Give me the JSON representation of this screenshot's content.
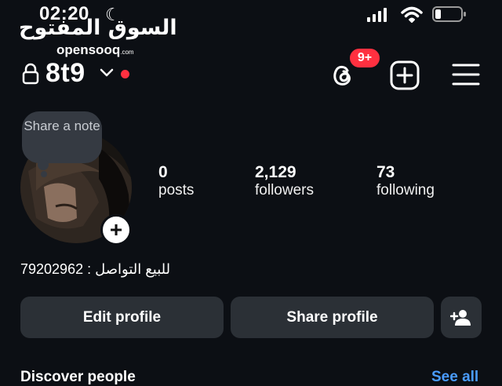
{
  "status_bar": {
    "time": "02:20",
    "watermark_arabic": "السوق المفتوح",
    "watermark_brand": "opensooq",
    "watermark_tld": ".com"
  },
  "header": {
    "username": "8t9",
    "notification_badge": "9+"
  },
  "profile": {
    "note_label": "Share a note",
    "stats": [
      {
        "value": "0",
        "label": "posts"
      },
      {
        "value": "2,129",
        "label": "followers"
      },
      {
        "value": "73",
        "label": "following"
      }
    ],
    "bio": "للبيع التواصل : 79202962"
  },
  "actions": {
    "edit_profile": "Edit profile",
    "share_profile": "Share profile"
  },
  "section": {
    "discover": "Discover people",
    "see_all": "See all"
  },
  "colors": {
    "background": "#0c0f14",
    "button": "#2b3036",
    "badge": "#ff3040",
    "link": "#4a9cff"
  }
}
